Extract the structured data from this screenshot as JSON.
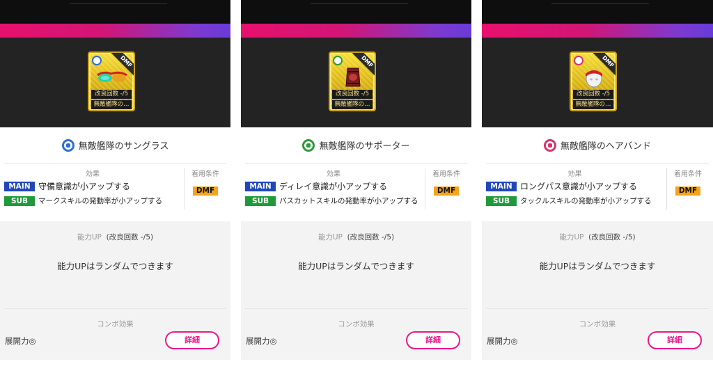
{
  "colors": {
    "main_tag": "#1f47b8",
    "sub_tag": "#1f9a3a",
    "position_badge": "#f4a41a",
    "accent_pink": "#e8198a"
  },
  "panels": [
    {
      "card": {
        "ribbon": "DMF",
        "icon": "sunglasses-icon",
        "type_icon_color": "#2b6fd6",
        "row1": "改良回数 -/5",
        "row2": "無敵艦隊の…"
      },
      "name": "無敵艦隊のサングラス",
      "effects_title": "効果",
      "main_label": "MAIN",
      "main_text": "守備意識が小アップする",
      "sub_label": "SUB",
      "sub_text": "マークスキルの発動率が小アップする",
      "condition_title": "着用条件",
      "position": "DMF",
      "ability_title": "能力UP",
      "ability_sub": "(改良回数 -/5)",
      "ability_text": "能力UPはランダムでつきます",
      "combo_title": "コンボ効果",
      "combo_value": "展開力◎",
      "detail_button": "詳細"
    },
    {
      "card": {
        "ribbon": "DMF",
        "icon": "supporter-icon",
        "type_icon_color": "#2a9a3a",
        "row1": "改良回数 -/5",
        "row2": "無敵艦隊の…"
      },
      "name": "無敵艦隊のサポーター",
      "effects_title": "効果",
      "main_label": "MAIN",
      "main_text": "ディレイ意識が小アップする",
      "sub_label": "SUB",
      "sub_text": "パスカットスキルの発動率が小アップする",
      "condition_title": "着用条件",
      "position": "DMF",
      "ability_title": "能力UP",
      "ability_sub": "(改良回数 -/5)",
      "ability_text": "能力UPはランダムでつきます",
      "combo_title": "コンボ効果",
      "combo_value": "展開力◎",
      "detail_button": "詳細"
    },
    {
      "card": {
        "ribbon": "DMF",
        "icon": "hairband-icon",
        "type_icon_color": "#d6336c",
        "row1": "改良回数 -/5",
        "row2": "無敵艦隊の…"
      },
      "name": "無敵艦隊のヘアバンド",
      "effects_title": "効果",
      "main_label": "MAIN",
      "main_text": "ロングパス意識が小アップする",
      "sub_label": "SUB",
      "sub_text": "タックルスキルの発動率が小アップする",
      "condition_title": "着用条件",
      "position": "DMF",
      "ability_title": "能力UP",
      "ability_sub": "(改良回数 -/5)",
      "ability_text": "能力UPはランダムでつきます",
      "combo_title": "コンボ効果",
      "combo_value": "展開力◎",
      "detail_button": "詳細"
    }
  ]
}
